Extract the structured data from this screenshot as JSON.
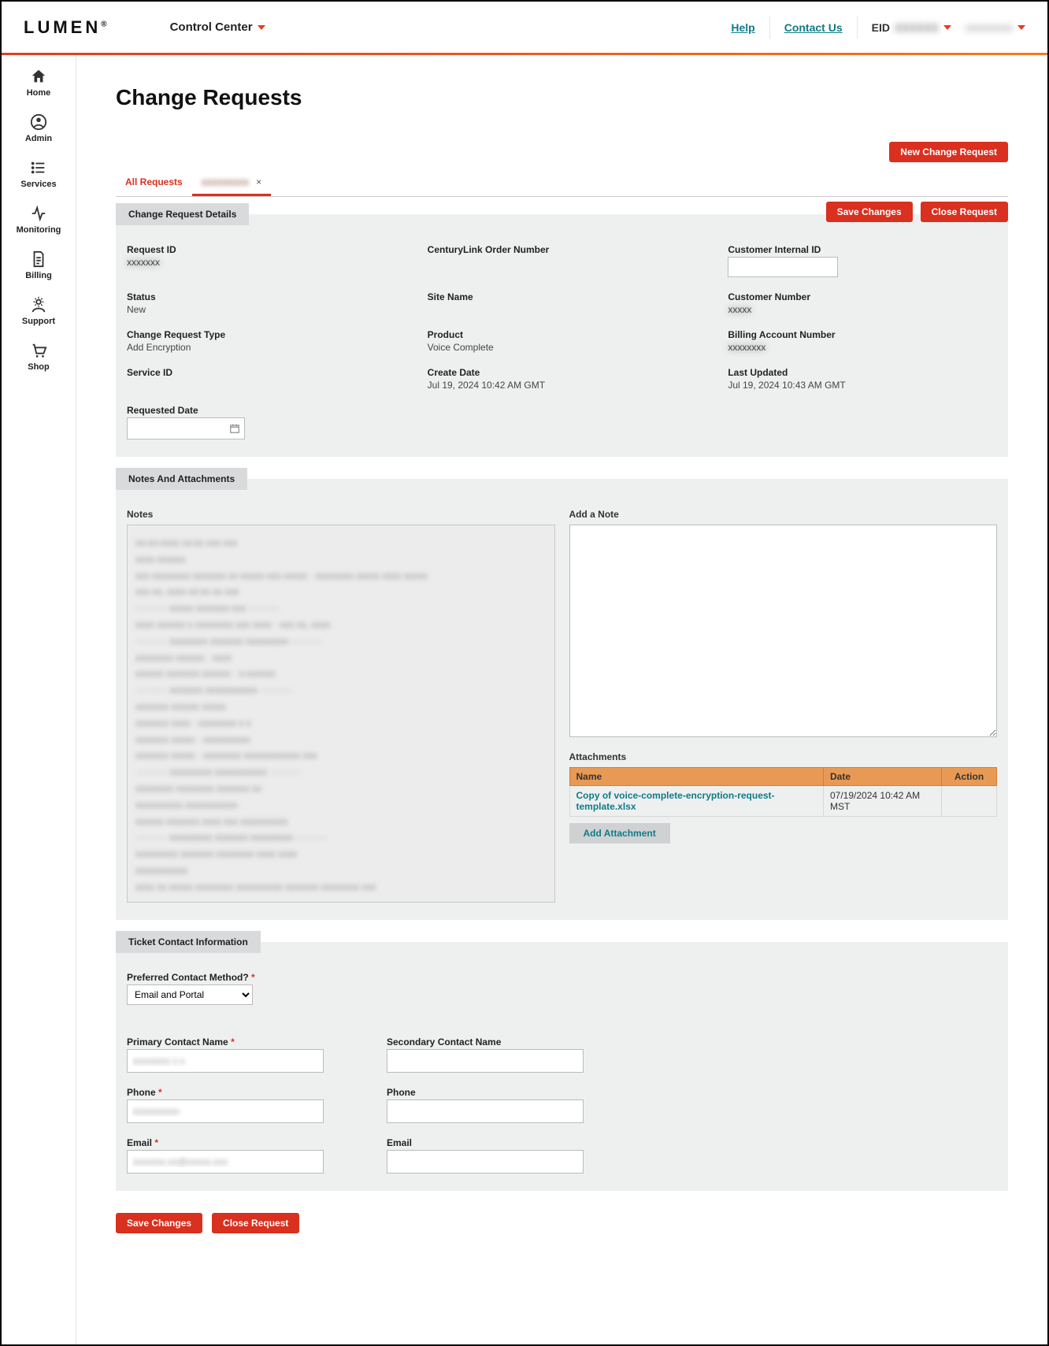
{
  "top": {
    "logo": "LUMEN",
    "app_name": "Control Center",
    "help": "Help",
    "contact": "Contact Us",
    "eid_label": "EID",
    "eid_value": "XXXXXX",
    "username": "xxxxxxxxxx"
  },
  "nav": {
    "home": "Home",
    "admin": "Admin",
    "services": "Services",
    "monitoring": "Monitoring",
    "billing": "Billing",
    "support": "Support",
    "shop": "Shop"
  },
  "page": {
    "title": "Change Requests",
    "new_request_btn": "New Change Request",
    "tab_all": "All Requests",
    "tab_detail": "xxxxxxxxx"
  },
  "details": {
    "header": "Change Request Details",
    "save_btn": "Save Changes",
    "close_btn": "Close Request",
    "request_id_label": "Request ID",
    "request_id_value": "xxxxxxx",
    "order_num_label": "CenturyLink Order Number",
    "customer_internal_id_label": "Customer Internal ID",
    "status_label": "Status",
    "status_value": "New",
    "site_name_label": "Site Name",
    "customer_number_label": "Customer Number",
    "customer_number_value": "xxxxx",
    "cr_type_label": "Change Request Type",
    "cr_type_value": "Add Encryption",
    "product_label": "Product",
    "product_value": "Voice Complete",
    "ban_label": "Billing Account Number",
    "ban_value": "xxxxxxxx",
    "service_id_label": "Service ID",
    "create_date_label": "Create Date",
    "create_date_value": "Jul 19, 2024 10:42 AM GMT",
    "last_updated_label": "Last Updated",
    "last_updated_value": "Jul 19, 2024 10:43 AM GMT",
    "requested_date_label": "Requested Date"
  },
  "notes": {
    "header": "Notes And Attachments",
    "notes_label": "Notes",
    "add_note_label": "Add a Note",
    "attachments_label": "Attachments",
    "col_name": "Name",
    "col_date": "Date",
    "col_action": "Action",
    "attachment_name": "Copy of voice-complete-encryption-request-template.xlsx",
    "attachment_date": "07/19/2024 10:42 AM MST",
    "add_attachment_btn": "Add Attachment",
    "notes_lines": [
      "xx-xx-xxxx xx:xx xxx xxx",
      "xxxx xxxxxx",
      "xxx xxxxxxxx xxxxxxx xx xxxxx xxx xxxxx · xxxxxxxx xxxxx xxxx xxxxx",
      " ",
      "xxx xx, xxxx xx:xx xx xxx",
      "·········· xxxxx xxxxxxx xxx ··········",
      "xxxx xxxxxx x xxxxxxxx xxx xxxx · xxx xx, xxxx",
      "·········· xxxxxxxx xxxxxxx xxxxxxxxx ··········",
      "xxxxxxxx xxxxxx · xxxx",
      "xxxxxx xxxxxxx xxxxxx · x-xxxxxx",
      "·········· xxxxxxx xxxxxxxxxxx ··········",
      "xxxxxxx xxxxxx xxxxx",
      "xxxxxxx xxxx · xxxxxxxx x x",
      "xxxxxxx xxxxx · xxxxxxxxxx",
      "xxxxxxx xxxxx · xxxxxxxx xxxxxxxxxxxx xxx",
      "·········· xxxxxxxxx xxxxxxxxxxx ··········",
      "xxxxxxxx xxxxxxxx xxxxxxx xx",
      "xxxxxxxxxx xxxxxxxxxxx",
      "xxxxxx xxxxxxx xxxx xxx xxxxxxxxxx",
      "·········· xxxxxxxxx xxxxxxx xxxxxxxxx ··········",
      "xxxxxxxxx xxxxxxx xxxxxxxx xxxx xxxx",
      " ",
      "xxxxxxxxxxx",
      "xxxx xx xxxxx xxxxxxxx xxxxxxxxxx xxxxxxx xxxxxxxx xxx"
    ]
  },
  "contact": {
    "header": "Ticket Contact Information",
    "pref_method_label": "Preferred Contact Method?",
    "pref_method_value": "Email and Portal",
    "primary_name_label": "Primary Contact Name",
    "primary_name_value": "xxxxxxxx x x",
    "secondary_name_label": "Secondary Contact Name",
    "phone_label": "Phone",
    "primary_phone_value": "xxxxxxxxxx",
    "email_label": "Email",
    "primary_email_value": "xxxxxxx.xx@xxxxx.xxx",
    "save_btn": "Save Changes",
    "close_btn": "Close Request"
  }
}
